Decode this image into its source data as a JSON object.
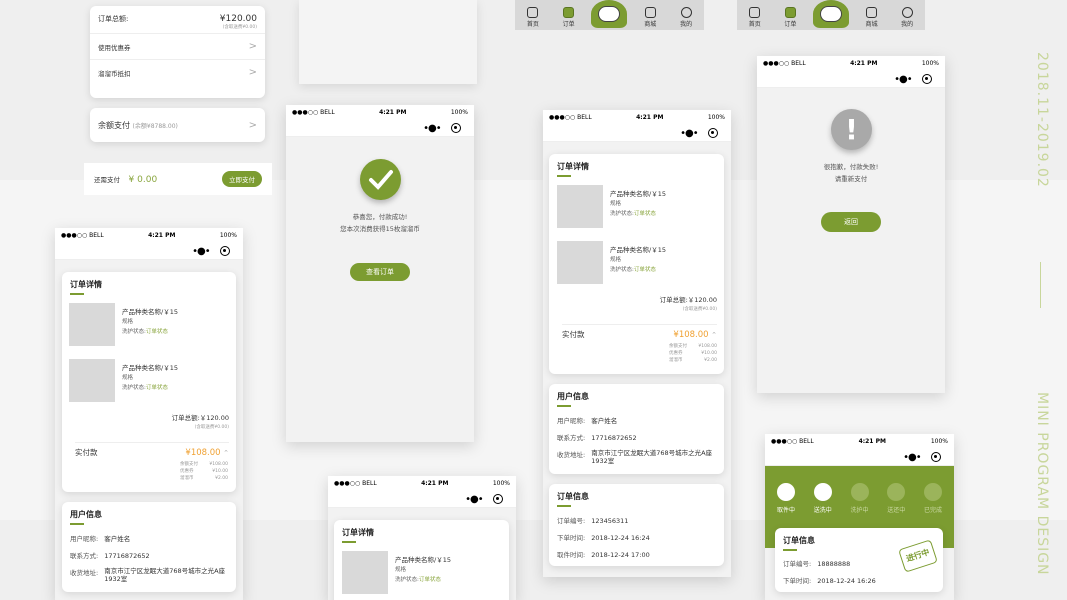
{
  "side_text": {
    "date_range": "2018.11-2019.02",
    "caption": "MINI PROGRAM DESIGN"
  },
  "status": {
    "carrier": "●●●○○ BELL",
    "time": "4:21 PM",
    "battery": "100%"
  },
  "tabs": [
    "首页",
    "订单",
    "商城",
    "我的"
  ],
  "payment_top": {
    "order_total_label": "订单总额:",
    "order_total": "¥120.00",
    "shipping_note": "(含取送费¥0.00)",
    "coupon_label": "使用优惠券",
    "coin_label": "溜溜币抵扣",
    "balance_label": "余额支付",
    "balance_note": "(余额¥8788.00)",
    "due_label": "还需支付",
    "due_value": "¥ 0.00",
    "pay_button": "立即支付"
  },
  "success": {
    "line1": "恭喜您，付款成功!",
    "line2": "您本次消费获得15枚溜溜币",
    "button": "查看订单"
  },
  "failure": {
    "line1": "很抱歉，付款失败!",
    "line2": "请重新支付",
    "button": "返回"
  },
  "order": {
    "title": "订单详情",
    "product_name": "产品种类名称/￥15",
    "spec": "规格",
    "status_label": "洗护状态:",
    "status_value": "订单状态",
    "total": "订单总额:￥120.00",
    "shipping": "(含取送费¥0.00)",
    "paid_label": "实付款",
    "paid_value": "¥108.00",
    "breakdown": [
      {
        "label": "余额支付",
        "value": "¥108.00"
      },
      {
        "label": "优惠券",
        "value": "¥10.00"
      },
      {
        "label": "溜溜币",
        "value": "¥2.00"
      }
    ]
  },
  "user": {
    "title": "用户信息",
    "nick_label": "用户昵称:",
    "nick": "客户姓名",
    "phone_label": "联系方式:",
    "phone": "17716872652",
    "addr_label": "收货地址:",
    "addr": "南京市江宁区龙眠大道768号城市之光A座1932室"
  },
  "order_info": {
    "title": "订单信息",
    "no_label": "订单编号:",
    "no": "123456311",
    "order_time_label": "下单时间:",
    "order_time": "2018-12-24  16:24",
    "pickup_label": "取件时间:",
    "pickup_time": "2018-12-24  17:00"
  },
  "progress": {
    "steps": [
      "取件中",
      "送洗中",
      "洗护中",
      "送还中",
      "已完成"
    ],
    "title": "订单信息",
    "no_label": "订单编号:",
    "no": "18888888",
    "time_label": "下单时间:",
    "time": "2018-12-24  16:26",
    "stamp": "进行中"
  },
  "colors": {
    "accent": "#7c9c31",
    "price": "#f0a132"
  }
}
